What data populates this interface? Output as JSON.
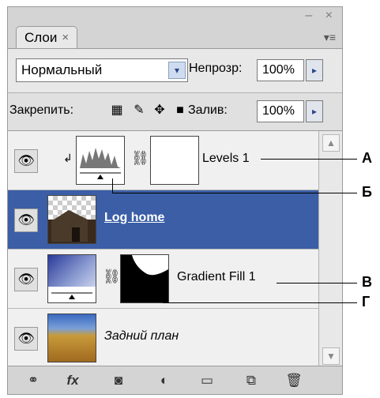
{
  "window": {
    "controls": "– ×",
    "menu": "▾≡"
  },
  "tab": {
    "label": "Слои",
    "close": "×"
  },
  "blend_mode": {
    "value": "Нормальный",
    "dropdown": "▾"
  },
  "opacity": {
    "label": "Непрозр:",
    "value": "100%",
    "arrow": "▸"
  },
  "lock": {
    "label": "Закрепить:"
  },
  "fill": {
    "label": "Залив:",
    "value": "100%",
    "arrow": "▸"
  },
  "layers": [
    {
      "name": "Levels 1",
      "selected": false
    },
    {
      "name": "Log home",
      "selected": true
    },
    {
      "name": "Gradient Fill 1",
      "selected": false
    },
    {
      "name": "Задний план",
      "selected": false
    }
  ],
  "callouts": [
    "А",
    "Б",
    "В",
    "Г"
  ],
  "colors": {
    "selected_layer": "#3b5ea6",
    "panel_bg": "#d4d4d4"
  },
  "footer_icons": [
    "link-icon",
    "fx-icon",
    "mask-icon",
    "adjustment-icon",
    "folder-icon",
    "new-layer-icon",
    "trash-icon"
  ]
}
